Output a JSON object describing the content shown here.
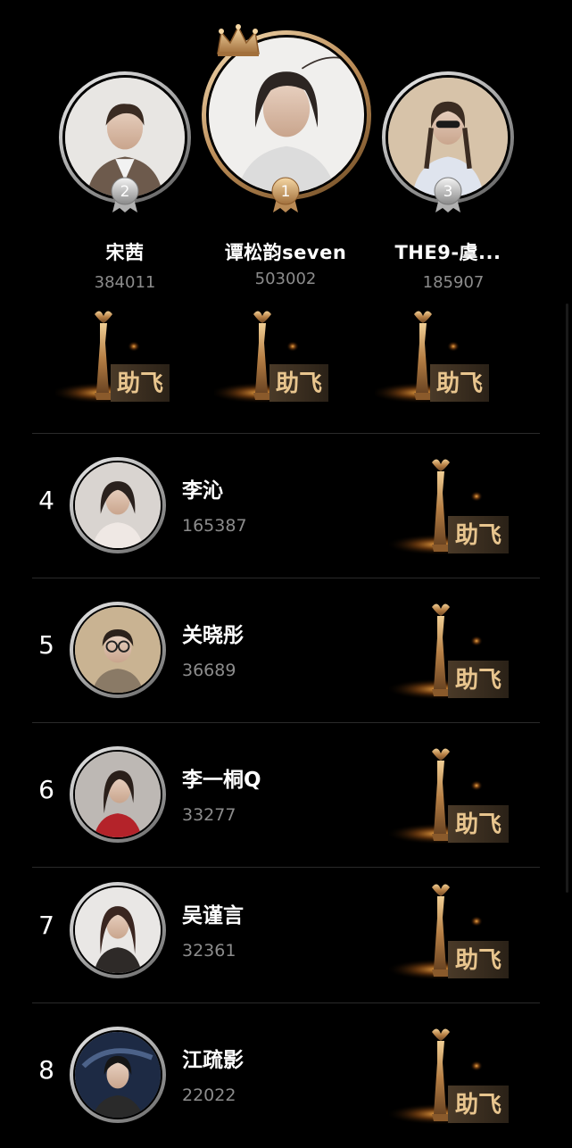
{
  "podium": [
    {
      "rank": "2",
      "name": "宋茜",
      "score": "384011",
      "boost_label": "助飞",
      "crown_icon": "none"
    },
    {
      "rank": "1",
      "name": "谭松韵seven",
      "score": "503002",
      "boost_label": "助飞",
      "crown_icon": "crown-icon"
    },
    {
      "rank": "3",
      "name": "THE9-虞...",
      "score": "185907",
      "boost_label": "助飞",
      "crown_icon": "none"
    }
  ],
  "list": [
    {
      "rank": "4",
      "name": "李沁",
      "score": "165387",
      "boost_label": "助飞"
    },
    {
      "rank": "5",
      "name": "关晓彤",
      "score": "36689",
      "boost_label": "助飞"
    },
    {
      "rank": "6",
      "name": "李一桐Q",
      "score": "33277",
      "boost_label": "助飞"
    },
    {
      "rank": "7",
      "name": "吴谨言",
      "score": "32361",
      "boost_label": "助飞"
    },
    {
      "rank": "8",
      "name": "江疏影",
      "score": "22022",
      "boost_label": "助飞"
    }
  ],
  "colors": {
    "background": "#000000",
    "gold": "#c9965a",
    "silver": "#b8b8b8",
    "score_gray": "#8c8c8c"
  }
}
